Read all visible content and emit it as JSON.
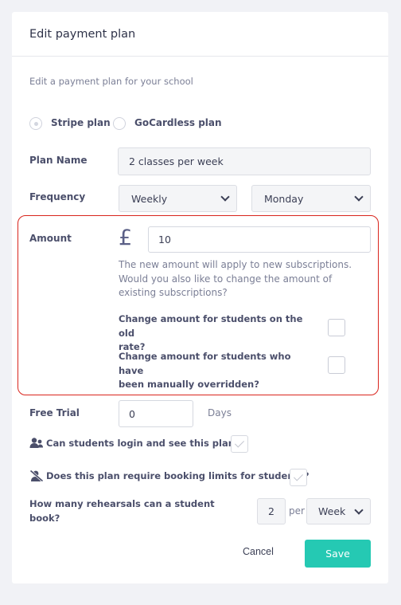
{
  "modal": {
    "title": "Edit payment plan",
    "subtitle": "Edit a payment plan for your school"
  },
  "plan_type": {
    "options": [
      "Stripe plan",
      "GoCardless plan"
    ],
    "selected": "Stripe plan"
  },
  "plan_name": {
    "label": "Plan Name",
    "value": "2 classes per week"
  },
  "frequency": {
    "label": "Frequency",
    "period": "Weekly",
    "day": "Monday"
  },
  "amount": {
    "label": "Amount",
    "currency_symbol": "£",
    "value": "10",
    "help": "The new amount will apply to new subscriptions. Would you also like to change the amount of existing subscriptions?",
    "option_old_rate_line1": "Change amount for students on the old",
    "option_old_rate_line2": "rate?",
    "option_overridden_line1": "Change amount for students who have",
    "option_overridden_line2": "been manually overridden?",
    "old_rate_checked": false,
    "overridden_checked": false
  },
  "free_trial": {
    "label": "Free Trial",
    "value": "0",
    "unit": "Days"
  },
  "login_visible": {
    "label": "Can students login and see this plan?",
    "checked": true
  },
  "booking_limits": {
    "label": "Does this plan require booking limits for students?",
    "checked": true
  },
  "rehearsals": {
    "label_line1": "How many rehearsals can a student",
    "label_line2": "book?",
    "value": "2",
    "per_label": "per",
    "period": "Week"
  },
  "actions": {
    "cancel_label": "Cancel",
    "save_label": "Save"
  },
  "colors": {
    "accent": "#25c9b3",
    "highlight_border": "#d9251d",
    "text": "#4b4f6b",
    "background": "#f1f2f6"
  }
}
